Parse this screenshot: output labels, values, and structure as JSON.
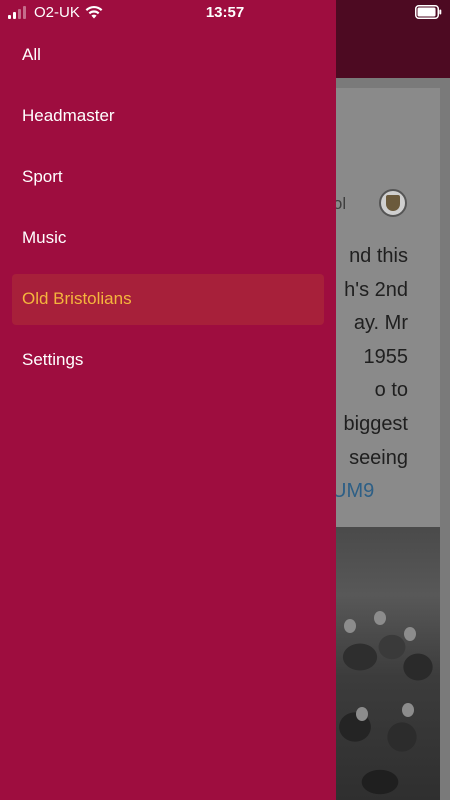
{
  "status_bar": {
    "carrier": "O2-UK",
    "time": "13:57",
    "signal_bars_active": 2,
    "signal_bars_total": 4,
    "battery_level": 0.95
  },
  "drawer": {
    "items": [
      {
        "label": "All",
        "active": false
      },
      {
        "label": "Headmaster",
        "active": false
      },
      {
        "label": "Sport",
        "active": false
      },
      {
        "label": "Music",
        "active": false
      },
      {
        "label": "Old Bristolians",
        "active": true
      },
      {
        "label": "Settings",
        "active": false
      }
    ]
  },
  "background_post": {
    "school_name_fragment": "hool",
    "text_lines": [
      "nd this",
      "h's 2nd",
      "ay. Mr",
      "1955",
      "o to",
      "biggest",
      "seeing"
    ],
    "link_fragment": "UM9"
  },
  "colors": {
    "drawer_bg": "#9e0d3f",
    "active_item_bg": "#a7203a",
    "active_item_text": "#f5b53d",
    "header_bg": "#4d0a22"
  }
}
